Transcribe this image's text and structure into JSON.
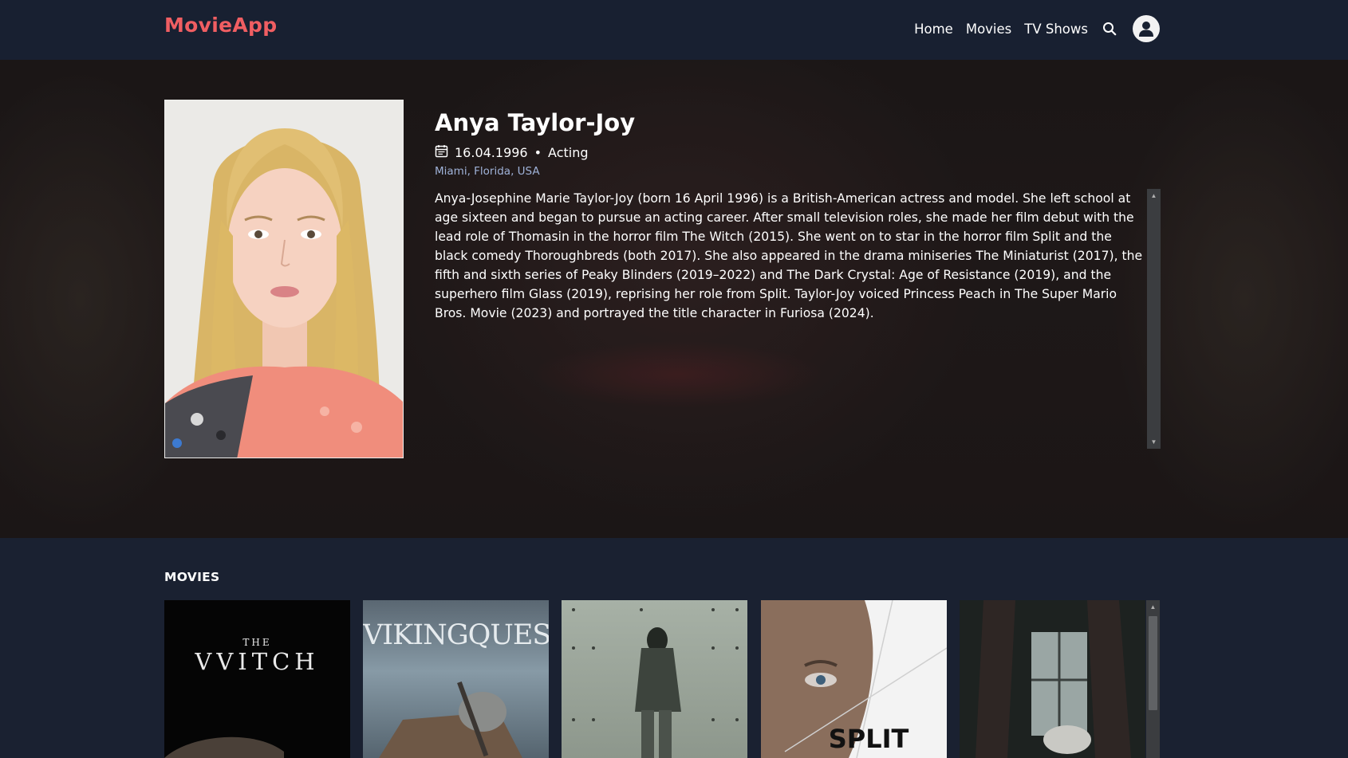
{
  "navbar": {
    "brand": "MovieApp",
    "links": [
      "Home",
      "Movies",
      "TV Shows"
    ],
    "search_icon": "search-icon",
    "avatar_icon": "user-icon",
    "brand_color": "#f05e62"
  },
  "person": {
    "name": "Anya Taylor-Joy",
    "birthday": "16.04.1996",
    "separator": "•",
    "department": "Acting",
    "birthplace": "Miami, Florida, USA",
    "biography": "Anya-Josephine Marie Taylor-Joy (born 16 April 1996) is a British-American actress and model. She left school at age sixteen and began to pursue an acting career. After small television roles, she made her film debut with the lead role of Thomasin in the horror film The Witch (2015). She went on to star in the horror film Split and the black comedy Thoroughbreds (both 2017). She also appeared in the drama miniseries The Miniaturist (2017), the fifth and sixth series of Peaky Blinders (2019–2022) and The Dark Crystal: Age of Resistance (2019), and the superhero film Glass (2019), reprising her role from Split. Taylor-Joy voiced Princess Peach in The Super Mario Bros. Movie (2023) and portrayed the title character in Furiosa (2024).",
    "calendar_icon": "calendar-icon"
  },
  "movies": {
    "title": "MOVIES",
    "posters": [
      {
        "text_top": "THE",
        "text_main": "VVITCH"
      },
      {
        "text_main": "VIKINGQUEST"
      },
      {
        "text_main": ""
      },
      {
        "text_main": "SPLIT"
      },
      {
        "text_main": ""
      }
    ]
  }
}
